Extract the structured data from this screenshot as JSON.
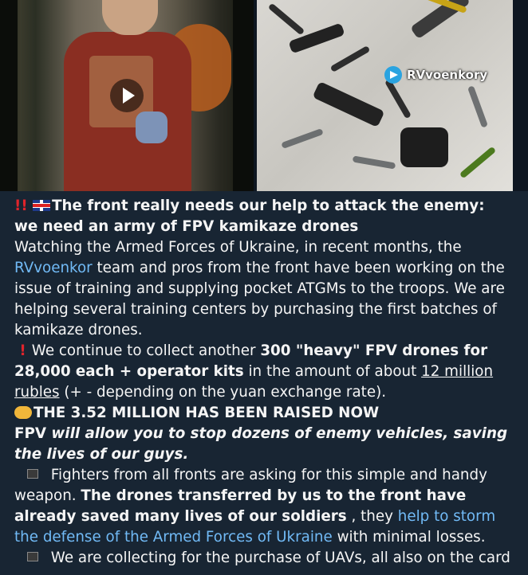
{
  "media": {
    "video_thumbnail": {
      "has_play_button": true
    },
    "photo": {
      "watermark": "RVvoenkory"
    }
  },
  "post": {
    "title_emoji": "‼️",
    "title": "The front really needs our help to attack the enemy: we need an army of FPV kamikaze drones",
    "p1_a": " Watching the Armed Forces of Ukraine, in recent months, the ",
    "p1_link": "RVvoenkor",
    "p1_b": " team and pros from the front have been working on the issue of training and supplying pocket ATGMs to the troops. We are helping several training centers by purchasing the first batches of kamikaze drones.",
    "p2_a": " We continue to collect another ",
    "p2_bold": "300 \"heavy\" FPV drones for 28,000 each + operator kits",
    "p2_b": " in the amount of about ",
    "p2_underline": "12 million rubles",
    "p2_c": " (+ - depending on the yuan exchange rate).",
    "raised": "THE 3.52 MILLION HAS BEEN RAISED NOW",
    "fpv_bold": "FPV",
    "fpv_italic": " will allow you to stop dozens of enemy vehicles, saving the lives of our guys.",
    "p3_a": " Fighters from all fronts are asking for this simple and handy weapon. ",
    "p3_bold": "The drones transferred by us to the front have already saved many lives of our soldiers",
    "p3_b": " , they ",
    "p3_link": "help to storm the defense of the Armed Forces of Ukraine",
    "p3_c": " with minimal losses.",
    "p4": " We are collecting for the purchase of UAVs, all also on the card"
  }
}
